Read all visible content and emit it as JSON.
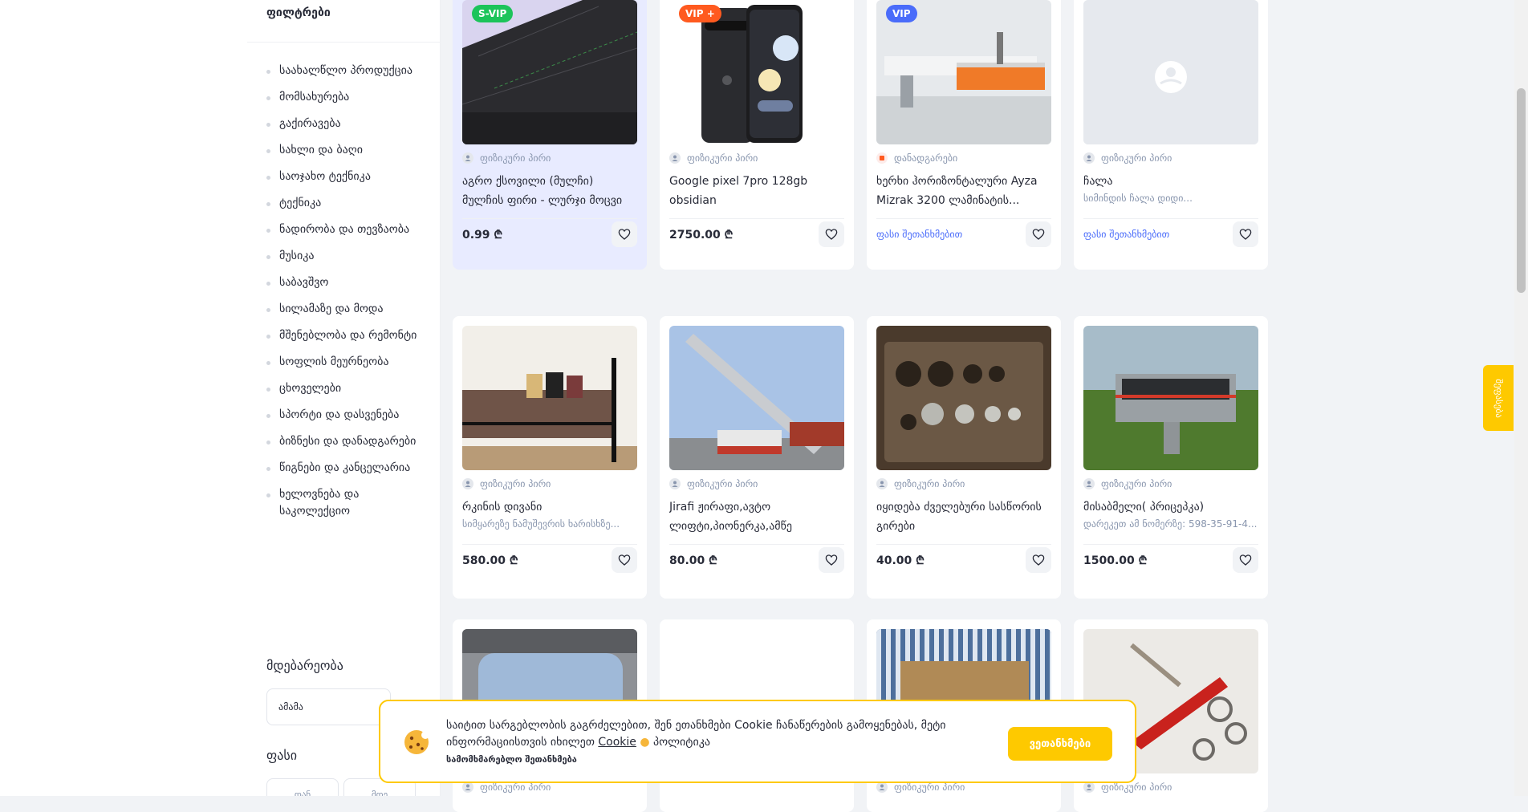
{
  "sidebar": {
    "filters_title": "ფილტრები",
    "categories": [
      "საახალწლო პროდუქცია",
      "მომსახურება",
      "გაქირავება",
      "სახლი და ბაღი",
      "საოჯახო ტექნიკა",
      "ტექნიკა",
      "ნადირობა და თევზაობა",
      "მუსიკა",
      "საბავშვო",
      "სილამაზე და მოდა",
      "მშენებლობა და რემონტი",
      "სოფლის მეურნეობა",
      "ცხოველები",
      "სპორტი და დასვენება",
      "ბიზნესი და დანადგარები",
      "წიგნები და კანცელარია",
      "ხელოვნება და საკოლექციო"
    ],
    "location_title": "მდებარეობა",
    "location_value": "ამამა",
    "price_title": "ფასი",
    "price_from": "დან",
    "price_to": "მდე"
  },
  "cards": [
    {
      "badge": "S-VIP",
      "seller": "ფიზიკური პირი",
      "title": "აგრო ქსოვილი (მულჩი) მულჩის ფირი - ლურჯი მოცვი",
      "desc": "",
      "price": "0.99 ₾"
    },
    {
      "badge": "VIP +",
      "seller": "ფიზიკური პირი",
      "title": "Google pixel 7pro 128gb obsidian",
      "desc": "",
      "price": "2750.00 ₾"
    },
    {
      "badge": "VIP",
      "seller": "დანადგარები",
      "title": "ხერხი ჰორიზონტალური Ayza Mizrak 3200 ლამინატის...",
      "desc": "",
      "price": "ფასი შეთანხმებით"
    },
    {
      "badge": "",
      "seller": "ფიზიკური პირი",
      "title": "ჩალა",
      "desc": "სიმინდის ჩალა დიდი...",
      "price": "ფასი შეთანხმებით"
    },
    {
      "badge": "",
      "seller": "ფიზიკური პირი",
      "title": "რკინის დივანი",
      "desc": "სიმყარეზე ნამუშევრის ხარისხზე...",
      "price": "580.00 ₾"
    },
    {
      "badge": "",
      "seller": "ფიზიკური პირი",
      "title": "Jirafi ჟირაფი,ავტო ლიფტი,პიონერკა,ამწე",
      "desc": "",
      "price": "80.00 ₾"
    },
    {
      "badge": "",
      "seller": "ფიზიკური პირი",
      "title": "იყიდება ძველებური სასწორის გირები",
      "desc": "",
      "price": "40.00 ₾"
    },
    {
      "badge": "",
      "seller": "ფიზიკური პირი",
      "title": "მისაბმელი( პრიცეპკა)",
      "desc": "დარეკეთ ამ ნომერზე: 598-35-91-4...",
      "price": "1500.00 ₾"
    },
    {
      "badge": "",
      "seller": "ფიზიკური პირი",
      "title": "",
      "desc": "",
      "price": ""
    },
    {
      "badge": "",
      "seller": "",
      "title": "",
      "desc": "",
      "price": ""
    },
    {
      "badge": "",
      "seller": "ფიზიკური პირი",
      "title": "",
      "desc": "",
      "price": ""
    },
    {
      "badge": "",
      "seller": "ფიზიკური პირი",
      "title": "",
      "desc": "",
      "price": ""
    }
  ],
  "feedback_label": "შეფასება",
  "cookie": {
    "text_before": "საიტით სარგებლობის გაგრძელებით, შენ ეთანხმები Cookie ჩანაწერების გამოყენებას, მეტი ინფორმაციისთვის იხილეთ ",
    "link": "Cookie",
    "text_after": " პოლიტიკა",
    "terms": "სამომხმარებლო შეთანხმება",
    "accept": "ვეთანხმები"
  },
  "colors": {
    "accent": "#fec900",
    "svip_badge": "#1cc45a",
    "vip_plus_badge": "#ff5a1f",
    "vip_badge": "#4a6cfa",
    "svip_card_bg": "#e8ebff",
    "negotiable_price": "#4a6cfa"
  }
}
